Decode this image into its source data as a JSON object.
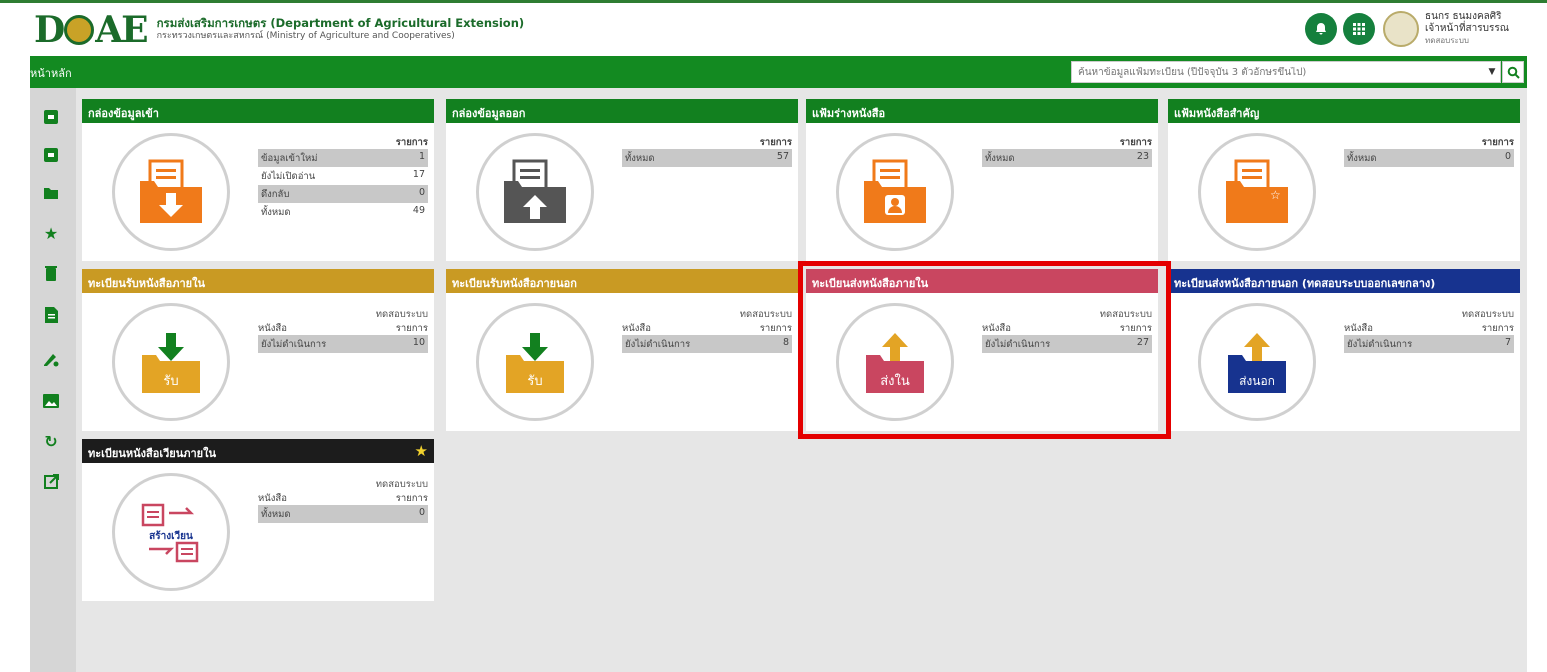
{
  "header": {
    "logo_text": "D AE",
    "org_name_th_en": "กรมส่งเสริมการเกษตร (Department of Agricultural Extension)",
    "ministry": "กระทรวงเกษตรและสหกรณ์ (Ministry of Agriculture and Cooperatives)",
    "user_name": "ธนกร ธนมงคลศิริ",
    "user_role": "เจ้าหน้าที่สารบรรณ",
    "user_org": "ทดสอบระบบ"
  },
  "nav": {
    "title": "หน้าหลัก",
    "search_placeholder": "ค้นหาข้อมูลแฟ้มทะเบียน (ปีปัจจุบัน 3 ตัวอักษรขึ้นไป)"
  },
  "sidebar": [
    {
      "icon": "inbox-icon"
    },
    {
      "icon": "outbox-icon"
    },
    {
      "icon": "folder-icon"
    },
    {
      "icon": "star-icon"
    },
    {
      "icon": "trash-icon"
    },
    {
      "icon": "document-icon"
    },
    {
      "icon": "edit-settings-icon"
    },
    {
      "icon": "image-icon"
    },
    {
      "icon": "refresh-icon"
    },
    {
      "icon": "external-link-icon"
    }
  ],
  "cards": {
    "inbox": {
      "title": "กล่องข้อมูลเข้า",
      "col": "รายการ",
      "rows": [
        {
          "label": "ข้อมูลเข้าใหม่",
          "value": "1"
        },
        {
          "label": "ยังไม่เปิดอ่าน",
          "value": "17"
        },
        {
          "label": "ดึงกลับ",
          "value": "0"
        },
        {
          "label": "ทั้งหมด",
          "value": "49"
        }
      ]
    },
    "outbox": {
      "title": "กล่องข้อมูลออก",
      "col": "รายการ",
      "rows": [
        {
          "label": "ทั้งหมด",
          "value": "57"
        }
      ]
    },
    "drafts": {
      "title": "แฟ้มร่างหนังสือ",
      "col": "รายการ",
      "rows": [
        {
          "label": "ทั้งหมด",
          "value": "23"
        }
      ]
    },
    "important": {
      "title": "แฟ้มหนังสือสำคัญ",
      "col": "รายการ",
      "rows": [
        {
          "label": "ทั้งหมด",
          "value": "0"
        }
      ]
    },
    "recv_internal": {
      "title": "ทะเบียนรับหนังสือภายใน",
      "tester": "ทดสอบระบบ",
      "col_left": "หนังสือ",
      "col": "รายการ",
      "rows": [
        {
          "label": "ยังไม่ดำเนินการ",
          "value": "10"
        }
      ],
      "icon_label": "รับ"
    },
    "recv_external": {
      "title": "ทะเบียนรับหนังสือภายนอก",
      "tester": "ทดสอบระบบ",
      "col_left": "หนังสือ",
      "col": "รายการ",
      "rows": [
        {
          "label": "ยังไม่ดำเนินการ",
          "value": "8"
        }
      ],
      "icon_label": "รับ"
    },
    "send_internal": {
      "title": "ทะเบียนส่งหนังสือภายใน",
      "tester": "ทดสอบระบบ",
      "col_left": "หนังสือ",
      "col": "รายการ",
      "rows": [
        {
          "label": "ยังไม่ดำเนินการ",
          "value": "27"
        }
      ],
      "icon_label": "ส่งใน"
    },
    "send_external": {
      "title": "ทะเบียนส่งหนังสือภายนอก (ทดสอบระบบออกเลขกลาง)",
      "tester": "ทดสอบระบบ",
      "col_left": "หนังสือ",
      "col": "รายการ",
      "rows": [
        {
          "label": "ยังไม่ดำเนินการ",
          "value": "7"
        }
      ],
      "icon_label": "ส่งนอก"
    },
    "circular": {
      "title": "ทะเบียนหนังสือเวียนภายใน",
      "tester": "ทดสอบระบบ",
      "col_left": "หนังสือ",
      "col": "รายการ",
      "rows": [
        {
          "label": "ทั้งหมด",
          "value": "0"
        }
      ],
      "icon_label": "สร้างเวียน"
    }
  },
  "colors": {
    "green": "#12801f",
    "orange": "#c99a23",
    "red": "#c94660",
    "blue": "#17338f",
    "black": "#1c1c1c",
    "folder_orange": "#f07a1a",
    "highlight": "#e40000"
  }
}
